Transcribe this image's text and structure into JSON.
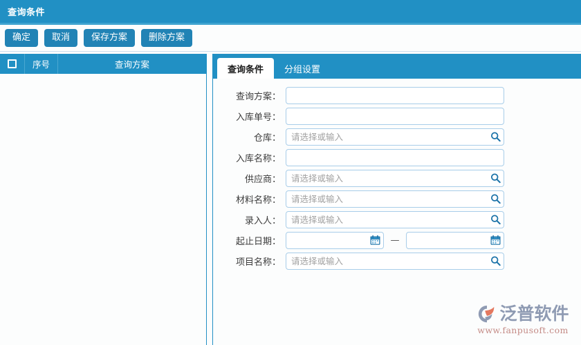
{
  "window": {
    "title": "查询条件"
  },
  "toolbar": {
    "buttons": [
      {
        "label": "确定",
        "name": "confirm-button"
      },
      {
        "label": "取消",
        "name": "cancel-button"
      },
      {
        "label": "保存方案",
        "name": "save-plan-button"
      },
      {
        "label": "删除方案",
        "name": "delete-plan-button"
      }
    ]
  },
  "left_panel": {
    "grid": {
      "columns": [
        "",
        "序号",
        "查询方案"
      ],
      "rows": []
    }
  },
  "right_panel": {
    "tabs": [
      {
        "label": "查询条件",
        "active": true
      },
      {
        "label": "分组设置",
        "active": false
      }
    ],
    "fields": [
      {
        "label": "查询方案：",
        "value": "",
        "placeholder": "",
        "icon": "none"
      },
      {
        "label": "入库单号：",
        "value": "",
        "placeholder": "",
        "icon": "none"
      },
      {
        "label": "仓库：",
        "value": "",
        "placeholder": "请选择或输入",
        "icon": "search-icon"
      },
      {
        "label": "入库名称：",
        "value": "",
        "placeholder": "",
        "icon": "none"
      },
      {
        "label": "供应商：",
        "value": "",
        "placeholder": "请选择或输入",
        "icon": "search-icon"
      },
      {
        "label": "材料名称：",
        "value": "",
        "placeholder": "请选择或输入",
        "icon": "search-icon"
      },
      {
        "label": "录入人：",
        "value": "",
        "placeholder": "请选择或输入",
        "icon": "search-icon"
      },
      {
        "label": "起止日期：",
        "value": "",
        "placeholder": "",
        "icon": "date-range"
      },
      {
        "label": "项目名称：",
        "value": "",
        "placeholder": "请选择或输入",
        "icon": "search-icon"
      }
    ],
    "date_range": {
      "start_value": "",
      "start_placeholder": "",
      "end_value": "",
      "end_placeholder": "",
      "separator": "—"
    }
  },
  "logo": {
    "name": "泛普软件",
    "url": "www.fanpusoft.com"
  },
  "colors": {
    "header_blue": "#2190c4",
    "button_blue": "#2183b5",
    "panel_background": "#fcfdfd",
    "input_border": "#a8cde9",
    "icon_blue": "#1a72a8",
    "logo_gray": "#8f9bb3",
    "logo_url_color": "#c48b86"
  }
}
